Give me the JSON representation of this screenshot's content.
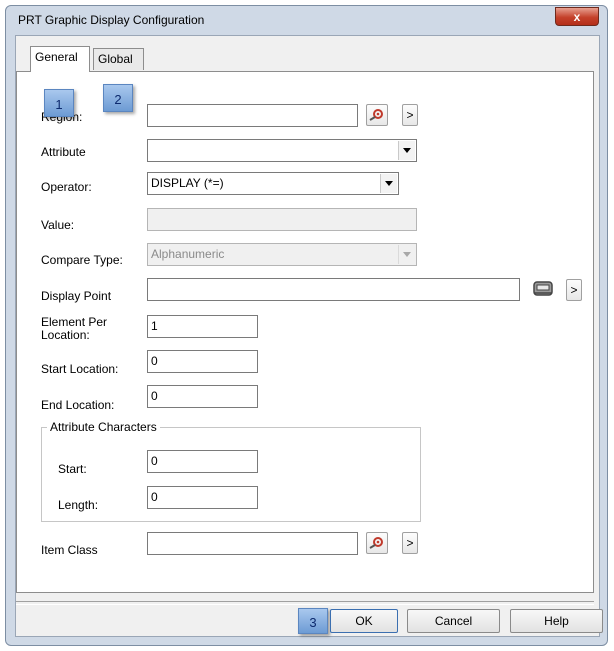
{
  "window": {
    "title": "PRT Graphic Display Configuration",
    "close_label": "x"
  },
  "tabs": [
    {
      "label": "General",
      "active": true
    },
    {
      "label": "Global",
      "active": false
    }
  ],
  "form": {
    "region_label": "Region:",
    "region_value": "",
    "attribute_label": "Attribute",
    "attribute_value": "",
    "operator_label": "Operator:",
    "operator_value": "DISPLAY (*=)",
    "value_label": "Value:",
    "value_value": "",
    "compare_type_label": "Compare Type:",
    "compare_type_value": "Alphanumeric",
    "display_point_label": "Display Point",
    "display_point_value": "",
    "element_per_location_label": "Element Per Location:",
    "element_per_location_value": "1",
    "start_location_label": "Start Location:",
    "start_location_value": "0",
    "end_location_label": "End Location:",
    "end_location_value": "0",
    "attribute_characters_label": "Attribute Characters",
    "start_label": "Start:",
    "start_value": "0",
    "length_label": "Length:",
    "length_value": "0",
    "item_class_label": "Item Class",
    "item_class_value": ""
  },
  "arrow_label": ">",
  "badges": [
    "1",
    "2",
    "3"
  ],
  "buttons": {
    "ok": "OK",
    "cancel": "Cancel",
    "help": "Help"
  },
  "icons": {
    "search": "search-icon",
    "display_point": "display-point-icon",
    "dropdown": "chevron-down-icon"
  },
  "colors": {
    "frame": "#cfd9e6",
    "close_button": "#c4412b",
    "badge": "#6d9bd4",
    "search_icon_accent": "#c0392b"
  }
}
